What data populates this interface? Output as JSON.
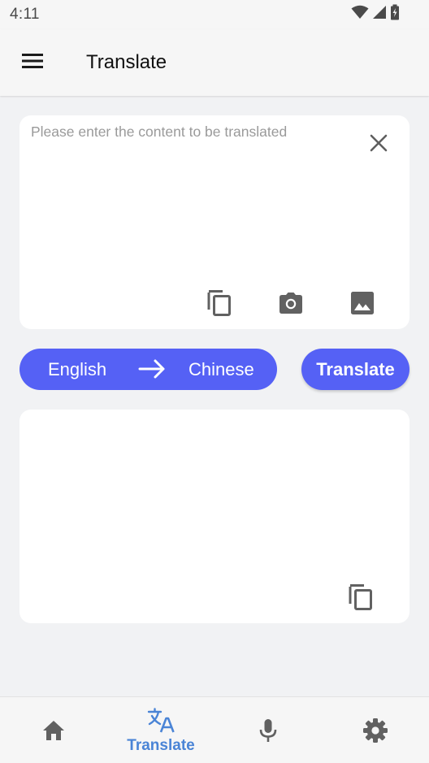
{
  "status_bar": {
    "time": "4:11",
    "icons": [
      "wifi-icon",
      "signal-icon",
      "battery-icon"
    ]
  },
  "app_bar": {
    "menu_icon": "menu-icon",
    "title": "Translate"
  },
  "input_card": {
    "text": "",
    "placeholder": "Please enter the content to be translated",
    "clear_icon": "close-icon",
    "tools": [
      "copy-icon",
      "camera-icon",
      "image-icon"
    ]
  },
  "language_bar": {
    "source": "English",
    "arrow_icon": "arrow-right-icon",
    "target": "Chinese"
  },
  "translate_button": {
    "label": "Translate"
  },
  "output_card": {
    "text": "",
    "copy_icon": "copy-icon"
  },
  "bottom_nav": {
    "items": [
      {
        "icon": "home-icon",
        "label": "",
        "active": false
      },
      {
        "icon": "translate-icon",
        "label": "Translate",
        "active": true
      },
      {
        "icon": "microphone-icon",
        "label": "",
        "active": false
      },
      {
        "icon": "settings-icon",
        "label": "",
        "active": false
      }
    ]
  },
  "colors": {
    "accent": "#5561f5",
    "active_nav": "#4a84d6",
    "inactive_icon": "#616161",
    "background": "#f1f2f4",
    "card": "#ffffff"
  }
}
